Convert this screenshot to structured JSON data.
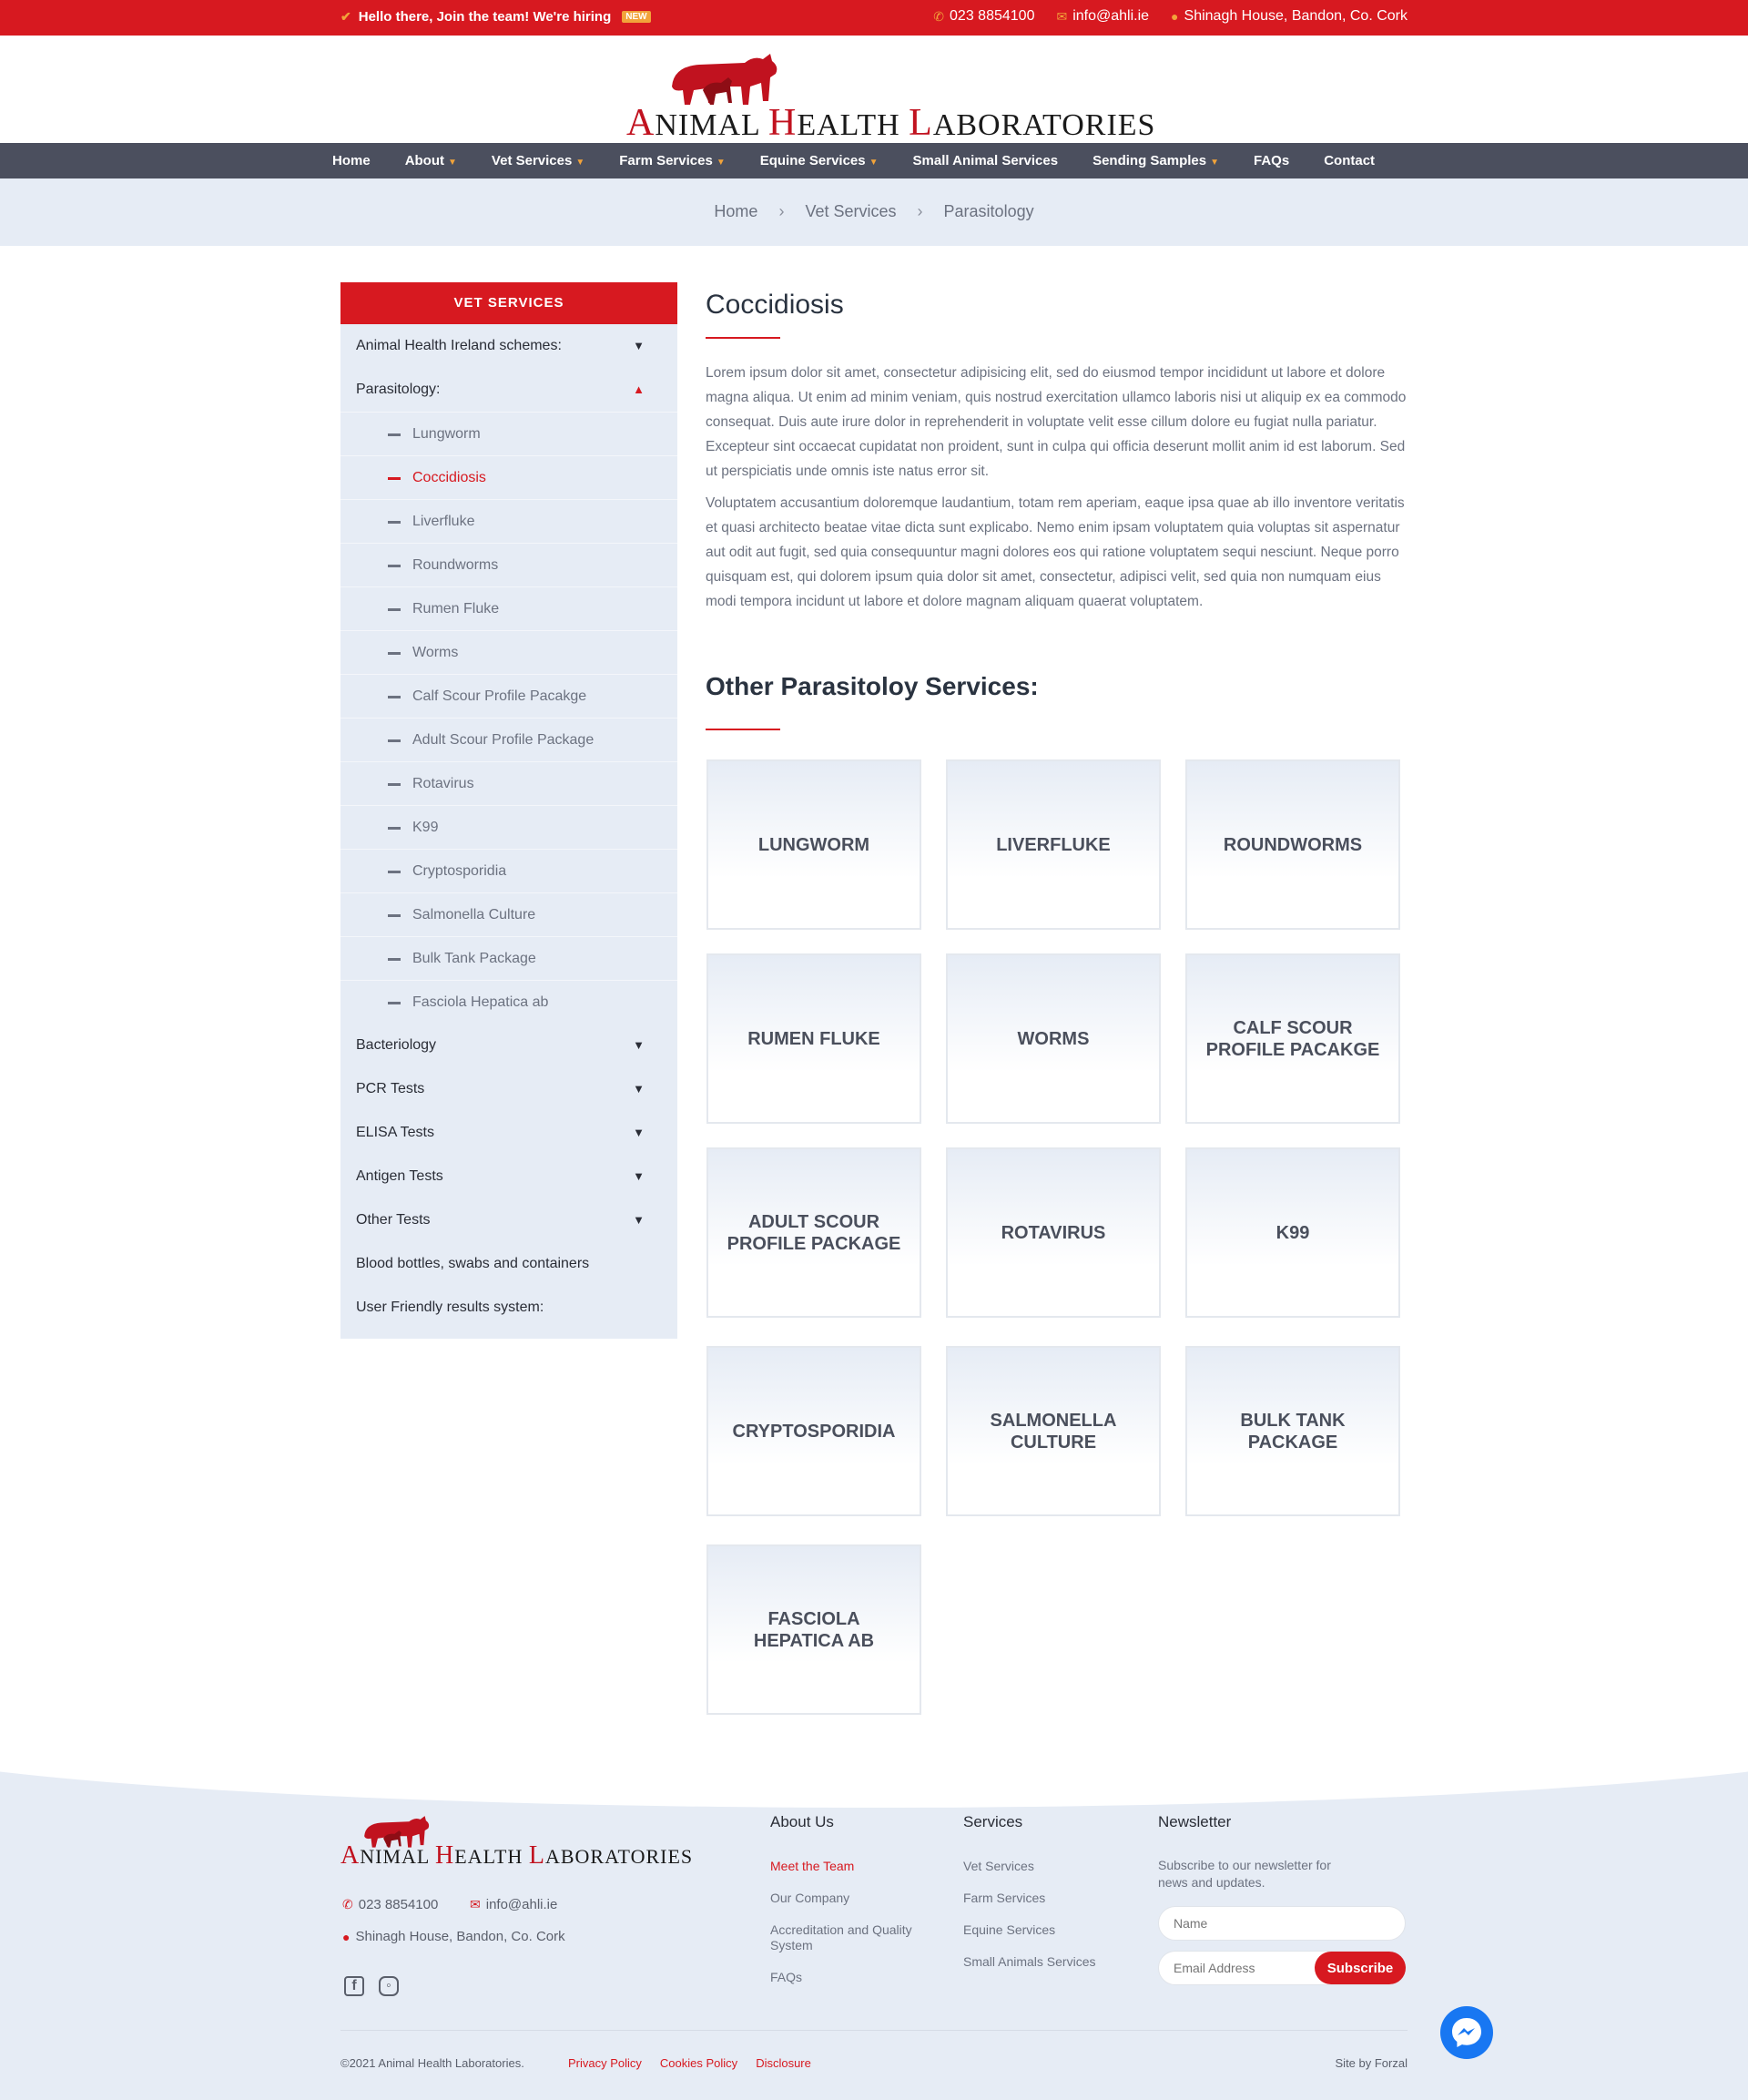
{
  "topbar": {
    "hiring_text": "Hello there, Join the team! We're hiring",
    "badge": "NEW",
    "phone": "023 8854100",
    "email": "info@ahli.ie",
    "address": "Shinagh House, Bandon, Co. Cork"
  },
  "logo": {
    "initial_1": "A",
    "word_1": "NIMAL",
    "initial_2": "H",
    "word_2": "EALTH",
    "initial_3": "L",
    "word_3": "ABORATORIES"
  },
  "nav": {
    "items": [
      {
        "label": "Home"
      },
      {
        "label": "About"
      },
      {
        "label": "Vet Services"
      },
      {
        "label": "Farm Services"
      },
      {
        "label": "Equine Services"
      },
      {
        "label": "Small Animal Services"
      },
      {
        "label": "Sending Samples"
      },
      {
        "label": "FAQs"
      },
      {
        "label": "Contact"
      }
    ]
  },
  "breadcrumb": {
    "items": [
      "Home",
      "Vet Services",
      "Parasitology"
    ]
  },
  "sidebar": {
    "title": "VET SERVICES",
    "items_top": [
      "Animal Health Ireland schemes:",
      "Parasitology:"
    ],
    "sub_items": [
      "Lungworm",
      "Coccidiosis",
      "Liverfluke",
      "Roundworms",
      "Rumen Fluke",
      "Worms",
      "Calf Scour Profile Pacakge",
      "Adult Scour Profile Package",
      "Rotavirus",
      "K99",
      "Cryptosporidia",
      "Salmonella Culture",
      "Bulk Tank Package",
      "Fasciola Hepatica ab"
    ],
    "items_bottom": [
      "Bacteriology",
      "PCR Tests",
      "ELISA Tests",
      "Antigen Tests",
      "Other Tests",
      "Blood bottles, swabs and containers",
      "User Friendly results system:"
    ]
  },
  "main": {
    "title": "Coccidiosis",
    "paragraph_1": "Lorem ipsum dolor sit amet, consectetur adipisicing elit, sed do eiusmod tempor incididunt ut labore et dolore magna aliqua. Ut enim ad minim veniam, quis nostrud exercitation ullamco laboris nisi ut aliquip ex ea commodo consequat. Duis aute irure dolor in reprehenderit in voluptate velit esse cillum dolore eu fugiat nulla pariatur. Excepteur sint occaecat cupidatat non proident, sunt in culpa qui officia deserunt mollit anim id est laborum. Sed ut perspiciatis unde omnis iste natus error sit.",
    "paragraph_2": "Voluptatem accusantium doloremque laudantium, totam rem aperiam, eaque ipsa quae ab illo inventore veritatis et quasi architecto beatae vitae dicta sunt explicabo. Nemo enim ipsam voluptatem quia voluptas sit aspernatur aut odit aut fugit, sed quia consequuntur magni dolores eos qui ratione voluptatem sequi nesciunt. Neque porro quisquam est, qui dolorem ipsum quia dolor sit amet, consectetur, adipisci velit, sed quia non numquam eius modi tempora incidunt ut labore et dolore magnam aliquam quaerat voluptatem.",
    "other_title": "Other Parasitoloy Services:",
    "cards": [
      "LUNGWORM",
      "LIVERFLUKE",
      "ROUNDWORMS",
      "RUMEN FLUKE",
      "WORMS",
      "CALF SCOUR PROFILE PACAKGE",
      "ADULT SCOUR PROFILE PACKAGE",
      "ROTAVIRUS",
      "K99",
      "CRYPTOSPORIDIA",
      "SALMONELLA CULTURE",
      "BULK TANK PACKAGE",
      "FASCIOLA HEPATICA AB"
    ]
  },
  "footer": {
    "phone": "023 8854100",
    "email": "info@ahli.ie",
    "address": "Shinagh House, Bandon, Co. Cork",
    "about_title": "About Us",
    "about_links": [
      "Meet the Team",
      "Our Company",
      "Accreditation and Quality System",
      "FAQs"
    ],
    "services_title": "Services",
    "services_links": [
      "Vet Services",
      "Farm Services",
      "Equine Services",
      "Small Animals Services"
    ],
    "newsletter_title": "Newsletter",
    "newsletter_text": "Subscribe to our newsletter for news and updates.",
    "name_placeholder": "Name",
    "email_placeholder": "Email Address",
    "subscribe_label": "Subscribe",
    "copyright": "©2021 Animal Health Laboratories.",
    "legal_links": [
      "Privacy Policy",
      "Cookies Policy",
      "Disclosure"
    ],
    "credit": "Site by Forzal"
  },
  "colors": {
    "brand_red": "#d71920",
    "nav_bg": "#4b4f5e",
    "light_bg": "#e6ecf5",
    "accent_orange": "#f2a33a"
  }
}
